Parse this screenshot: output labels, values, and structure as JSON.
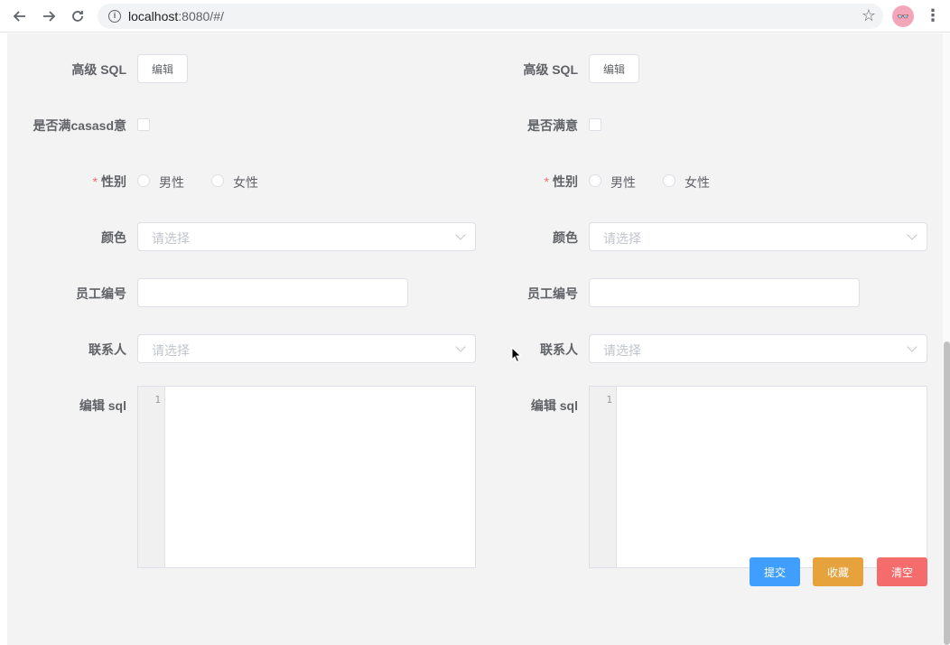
{
  "browser": {
    "url_host": "localhost",
    "url_rest": ":8080/#/"
  },
  "form_left": {
    "advanced_sql_label": "高级 SQL",
    "edit_button": "编辑",
    "satisfied_label": "是否满casasd意",
    "gender_label": "性别",
    "gender_options": [
      "男性",
      "女性"
    ],
    "color_label": "颜色",
    "color_placeholder": "请选择",
    "employee_id_label": "员工编号",
    "employee_id_value": "",
    "contact_label": "联系人",
    "contact_placeholder": "请选择",
    "edit_sql_label": "编辑 sql",
    "line_number": "1"
  },
  "form_right": {
    "advanced_sql_label": "高级 SQL",
    "edit_button": "编辑",
    "satisfied_label": "是否满意",
    "gender_label": "性别",
    "gender_options": [
      "男性",
      "女性"
    ],
    "color_label": "颜色",
    "color_placeholder": "请选择",
    "employee_id_label": "员工编号",
    "employee_id_value": "",
    "contact_label": "联系人",
    "contact_placeholder": "请选择",
    "edit_sql_label": "编辑 sql",
    "line_number": "1"
  },
  "required_mark": "*",
  "actions": {
    "submit": "提交",
    "favorite": "收藏",
    "clear": "清空"
  },
  "colors": {
    "submit": "#409eff",
    "favorite": "#e6a23c",
    "clear": "#f56c6c"
  }
}
